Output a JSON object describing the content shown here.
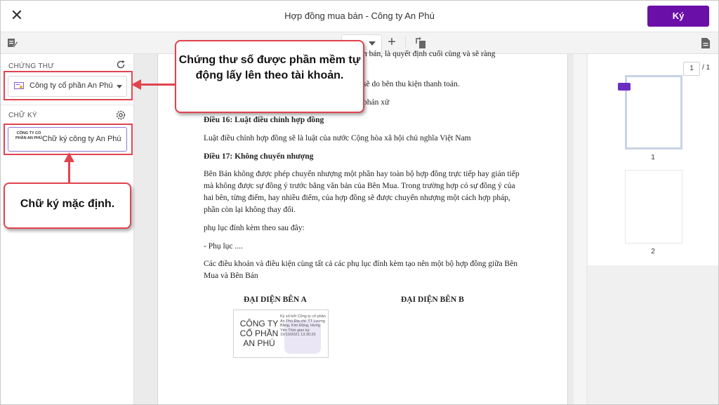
{
  "header": {
    "title": "Hợp đồng mua bán - Công ty An Phú",
    "sign_label": "Ký"
  },
  "toolbar": {
    "zoom_value": ""
  },
  "sidebar": {
    "cert_section_label": "CHỨNG THƯ",
    "cert_selected": "Công ty cổ phần An Phú",
    "sig_section_label": "CHỮ KÝ",
    "sig_thumb_text": "CÔNG TY CỔ PHẦN AN PHÚ",
    "sig_name": "Chữ ký công ty An Phú"
  },
  "document": {
    "lines": [
      {
        "text": "n bán, là quyết định cuối cùng và sẽ ràng",
        "bold": false
      },
      {
        "text": "sẽ do bên thu kiện thanh toán.",
        "bold": false
      },
      {
        "text": "phán xử",
        "bold": false
      },
      {
        "text": "Điều 16: Luật điều chỉnh hợp đồng",
        "bold": true
      },
      {
        "text": "Luật điều chỉnh hợp đồng sẽ là luật của nước Cộng hòa xã hội chủ nghĩa Việt Nam",
        "bold": false
      },
      {
        "text": "Điều 17: Không chuyển nhượng",
        "bold": true
      },
      {
        "text": "Bên Bán không được phép chuyển nhượng một phần hay toàn bộ hợp đồng trực tiếp hay gián tiếp mà không được sự đồng ý trước bằng văn bản của Bên Mua. Trong trường hợp có sự đồng ý của hai bên, từng điểm, hay nhiều điểm, của hợp đồng sẽ được chuyển nhượng một cách hợp pháp, phần còn lại không thay đổi.",
        "bold": false
      },
      {
        "text": "phụ lục đính kèm theo sau đây:",
        "bold": false
      },
      {
        "text": "- Phụ lục ....",
        "bold": false
      },
      {
        "text": "Các điều khoản và điều kiện cùng tất cả các phụ lục đính kèm tạo nên một bộ hợp đồng giữa Bên Mua và Bên Bán",
        "bold": false
      }
    ],
    "rep_a": "ĐẠI DIỆN BÊN A",
    "rep_b": "ĐẠI DIỆN BÊN B",
    "sig_company": "CÔNG TY CỔ PHẦN AN PHÚ",
    "sig_info": "Ký số bởi Công ty cổ phần An Phú Địa chỉ: TT Lương Bằng, Kim Động, Hưng Yên Thời gian ký: 19/10/2021 13:30:23"
  },
  "thumbnails": {
    "current_page": "1",
    "total": "/ 1",
    "labels": [
      "1",
      "2"
    ]
  },
  "callouts": {
    "cert_note": "Chứng thư số được phần mềm tự động lấy lên theo tài khoản.",
    "sig_note": "Chữ ký mặc định."
  },
  "colors": {
    "primary": "#6a0fa8",
    "annotation": "#e0444f"
  }
}
